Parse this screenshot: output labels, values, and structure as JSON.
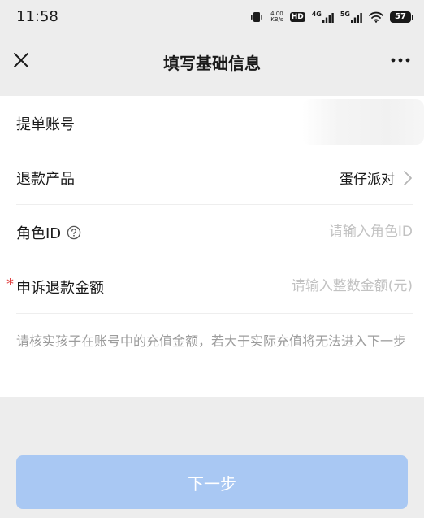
{
  "status_bar": {
    "time": "11:58",
    "net_speed_value": "4.00",
    "net_speed_unit": "KB/s",
    "hd_badge": "HD",
    "net1_label": "4G",
    "net2_label": "5G",
    "battery": "57"
  },
  "nav": {
    "title": "填写基础信息",
    "close_icon": "close-icon",
    "more_icon": "more-dots-icon"
  },
  "form": {
    "account_label": "提单账号",
    "product_label": "退款产品",
    "product_value": "蛋仔派对",
    "role_label": "角色ID",
    "role_placeholder": "请输入角色ID",
    "amount_required_mark": "*",
    "amount_label": "申诉退款金额",
    "amount_placeholder": "请输入整数金额(元)",
    "hint": "请核实孩子在账号中的充值金额，若大于实际充值将无法进入下一步"
  },
  "footer": {
    "next_label": "下一步"
  },
  "colors": {
    "page_bg": "#ededed",
    "card_bg": "#ffffff",
    "button_bg": "#a9c8f3",
    "required": "#e04343",
    "placeholder": "#c2c2c2",
    "hint": "#9c9c9c"
  }
}
